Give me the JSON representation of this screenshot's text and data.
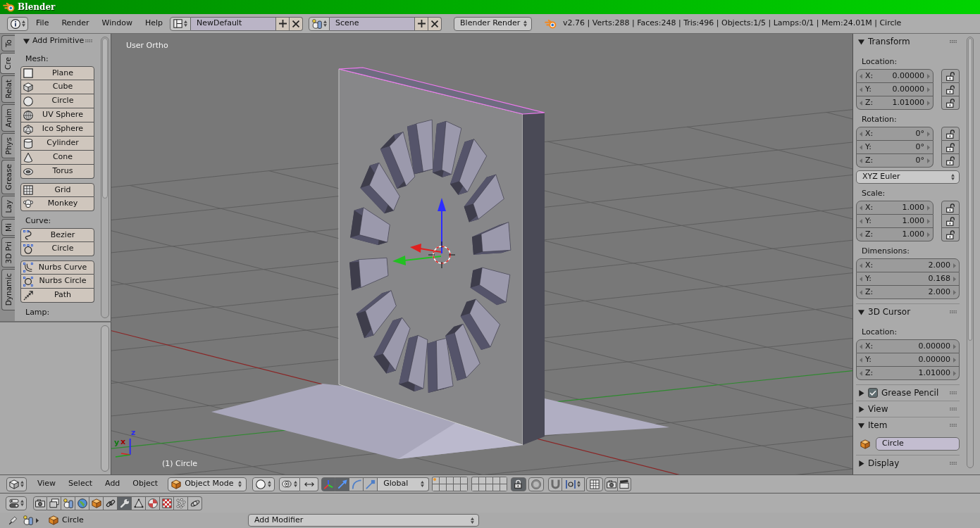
{
  "window": {
    "title": "Blender"
  },
  "info_header": {
    "menus": [
      "File",
      "Render",
      "Window",
      "Help"
    ],
    "screen_layout": "NewDefault",
    "scene": "Scene",
    "render_engine": "Blender Render",
    "stats": "v2.76 | Verts:288 | Faces:248 | Tris:496 | Objects:1/5 | Lamps:0/1 | Mem:24.01M | Circle"
  },
  "tool_shelf": {
    "tabs": [
      {
        "label": "To",
        "selected": false
      },
      {
        "label": "Cre",
        "selected": true
      },
      {
        "label": "Relat",
        "selected": false
      },
      {
        "label": "Anim",
        "selected": false
      },
      {
        "label": "Phys",
        "selected": false
      },
      {
        "label": "Grease",
        "selected": false
      },
      {
        "label": "Lay",
        "selected": false
      },
      {
        "label": "Mi",
        "selected": false
      },
      {
        "label": "3D Pri",
        "selected": false
      },
      {
        "label": "Dynamic",
        "selected": false
      }
    ],
    "panel": {
      "title": "Add Primitive",
      "expanded": true,
      "sections": [
        {
          "label": "Mesh:",
          "groups": [
            [
              "Plane",
              "Cube",
              "Circle",
              "UV Sphere",
              "Ico Sphere",
              "Cylinder",
              "Cone",
              "Torus"
            ],
            [
              "Grid",
              "Monkey"
            ]
          ]
        },
        {
          "label": "Curve:",
          "groups": [
            [
              "Bezier",
              "Circle"
            ],
            [
              "Nurbs Curve",
              "Nurbs Circle",
              "Path"
            ]
          ]
        },
        {
          "label": "Lamp:"
        }
      ]
    }
  },
  "viewport": {
    "view_name": "User Ortho",
    "object_label": "(1) Circle",
    "axis_labels": [
      {
        "text": "z",
        "color": "#2a2af0"
      },
      {
        "text": "x",
        "color": "#a00000"
      },
      {
        "text": "y",
        "color": "#107a10"
      }
    ]
  },
  "sidebar": {
    "panels": [
      {
        "title": "Transform",
        "expanded": true,
        "groups": [
          {
            "kind": "vector",
            "label": "Location:",
            "fields": [
              {
                "axis": "X:",
                "value": "0.00000",
                "locked": false
              },
              {
                "axis": "Y:",
                "value": "0.00000",
                "locked": false
              },
              {
                "axis": "Z:",
                "value": "1.01000",
                "locked": false
              }
            ]
          },
          {
            "kind": "vector",
            "label": "Rotation:",
            "fields": [
              {
                "axis": "X:",
                "value": "0°",
                "locked": false
              },
              {
                "axis": "Y:",
                "value": "0°",
                "locked": false
              },
              {
                "axis": "Z:",
                "value": "0°",
                "locked": false
              }
            ]
          },
          {
            "kind": "dropdown",
            "value": "XYZ Euler"
          },
          {
            "kind": "vector",
            "label": "Scale:",
            "fields": [
              {
                "axis": "X:",
                "value": "1.000",
                "locked": false
              },
              {
                "axis": "Y:",
                "value": "1.000",
                "locked": false
              },
              {
                "axis": "Z:",
                "value": "1.000",
                "locked": false
              }
            ]
          },
          {
            "kind": "vector",
            "label": "Dimensions:",
            "fields": [
              {
                "axis": "X:",
                "value": "2.000"
              },
              {
                "axis": "Y:",
                "value": "0.168"
              },
              {
                "axis": "Z:",
                "value": "2.000"
              }
            ]
          }
        ]
      },
      {
        "title": "3D Cursor",
        "expanded": true,
        "groups": [
          {
            "kind": "vector",
            "label": "Location:",
            "fields": [
              {
                "axis": "X:",
                "value": "0.00000"
              },
              {
                "axis": "Y:",
                "value": "0.00000"
              },
              {
                "axis": "Z:",
                "value": "1.01000"
              }
            ]
          }
        ]
      },
      {
        "title": "Grease Pencil",
        "expanded": false,
        "checkbox": {
          "checked": true
        }
      },
      {
        "title": "View",
        "expanded": false
      },
      {
        "title": "Item",
        "expanded": true,
        "groups": [
          {
            "kind": "name",
            "value": "Circle"
          }
        ]
      },
      {
        "title": "Display",
        "expanded": false
      }
    ]
  },
  "view3d_header": {
    "menus": [
      "View",
      "Select",
      "Add",
      "Object"
    ],
    "mode": "Object Mode",
    "manipulators": [
      {
        "on": true
      },
      {
        "on": true
      },
      {
        "on": false
      },
      {
        "on": false
      }
    ],
    "orientation": "Global",
    "layers": [
      {
        "occupied": true
      },
      {
        "occupied": false
      },
      {
        "occupied": false
      },
      {
        "occupied": false
      },
      {
        "occupied": false
      },
      {
        "occupied": false
      },
      {
        "occupied": false
      },
      {
        "occupied": false
      },
      {
        "occupied": false
      },
      {
        "occupied": false
      },
      {
        "occupied": false
      },
      {
        "occupied": false
      },
      {
        "occupied": false
      },
      {
        "occupied": false
      },
      {
        "occupied": false
      },
      {
        "occupied": false
      },
      {
        "occupied": false
      },
      {
        "occupied": false
      },
      {
        "occupied": false
      },
      {
        "occupied": false
      }
    ],
    "lock_layers": {
      "on": true
    },
    "proportional_editing": {
      "on": false
    },
    "snap": {
      "on": false
    }
  },
  "properties_editor": {
    "tabs": [
      {
        "selected": false
      },
      {
        "selected": false
      },
      {
        "selected": false
      },
      {
        "selected": false
      },
      {
        "selected": false
      },
      {
        "selected": false
      },
      {
        "selected": true
      },
      {
        "selected": false
      },
      {
        "selected": false
      },
      {
        "selected": false
      },
      {
        "selected": false
      },
      {
        "selected": false
      }
    ],
    "object_name": "Circle",
    "add_modifier": "Add Modifier"
  }
}
